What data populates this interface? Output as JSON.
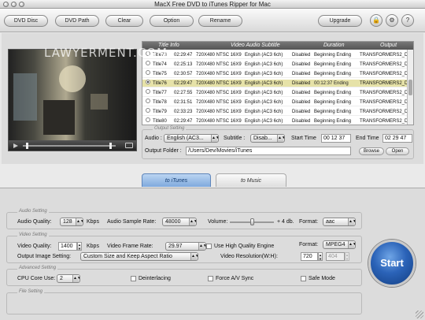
{
  "window": {
    "title": "MacX Free DVD to iTunes Ripper for Mac"
  },
  "toolbar": {
    "dvd_disc": "DVD Disc",
    "dvd_path": "DVD Path",
    "clear": "Clear",
    "option": "Option",
    "rename": "Rename",
    "upgrade": "Upgrade",
    "question_glyph": "?",
    "lock_glyph": "🔒",
    "gear_glyph": "⚙"
  },
  "player": {
    "watermark": "LAWYERMENT.COM"
  },
  "table": {
    "headers": {
      "title": "Title Info",
      "video_audio": "Video Audio Subtitle",
      "duration": "Duration",
      "output": "Output"
    },
    "rows": [
      {
        "title": "Title73",
        "time": "02:29:47",
        "video": "720X480 NTSC 16X9",
        "audio": "English (AC3 6ch)",
        "sub": "Disabled",
        "duration": "Beginning Ending",
        "output": "TRANSFORMERS2_DISC",
        "selected": false
      },
      {
        "title": "Title74",
        "time": "02:25:13",
        "video": "720X480 NTSC 16X9",
        "audio": "English (AC3 6ch)",
        "sub": "Disabled",
        "duration": "Beginning Ending",
        "output": "TRANSFORMERS2_DISC",
        "selected": false
      },
      {
        "title": "Title75",
        "time": "02:30:57",
        "video": "720X480 NTSC 16X9",
        "audio": "English (AC3 6ch)",
        "sub": "Disabled",
        "duration": "Beginning Ending",
        "output": "TRANSFORMERS2_DISC",
        "selected": false
      },
      {
        "title": "Title76",
        "time": "02:29:47",
        "video": "720X480 NTSC 16X9",
        "audio": "English (AC3 6ch)",
        "sub": "Disabled",
        "duration": "00:12:37 Ending",
        "output": "TRANSFORMERS2_DISC",
        "selected": true
      },
      {
        "title": "Title77",
        "time": "02:27:55",
        "video": "720X480 NTSC 16X9",
        "audio": "English (AC3 6ch)",
        "sub": "Disabled",
        "duration": "Beginning Ending",
        "output": "TRANSFORMERS2_DISC",
        "selected": false
      },
      {
        "title": "Title78",
        "time": "02:31:51",
        "video": "720X480 NTSC 16X9",
        "audio": "English (AC3 6ch)",
        "sub": "Disabled",
        "duration": "Beginning Ending",
        "output": "TRANSFORMERS2_DISC",
        "selected": false
      },
      {
        "title": "Title79",
        "time": "02:33:23",
        "video": "720X480 NTSC 16X9",
        "audio": "English (AC3 6ch)",
        "sub": "Disabled",
        "duration": "Beginning Ending",
        "output": "TRANSFORMERS2_DISC",
        "selected": false
      },
      {
        "title": "Title80",
        "time": "02:29:47",
        "video": "720X480 NTSC 16X9",
        "audio": "English (AC3 6ch)",
        "sub": "Disabled",
        "duration": "Beginning Ending",
        "output": "TRANSFORMERS2_DISC",
        "selected": false
      }
    ]
  },
  "output_setting": {
    "group_title": "Output Setting",
    "audio_label": "Audio :",
    "audio_value": "English (AC3...",
    "subtitle_label": "Subtitle :",
    "subtitle_value": "Disab...",
    "start_time_label": "Start Time",
    "start_time": "00 12 37",
    "end_time_label": "End Time",
    "end_time": "02 29 47",
    "folder_label": "Output Folder :",
    "folder_value": "/Users/Dev/Movies/iTunes",
    "browse": "Browse",
    "open": "Open"
  },
  "tabs": {
    "itunes": "to iTunes",
    "music": "to Music"
  },
  "audio_setting": {
    "group_title": "Audio Setting",
    "quality_label": "Audio Quality:",
    "quality_value": "128",
    "quality_unit": "Kbps",
    "sample_rate_label": "Audio Sample Rate:",
    "sample_rate_value": "48000",
    "volume_label": "Volume:",
    "volume_value": "+ 4 db.",
    "format_label": "Format:",
    "format_value": "aac"
  },
  "video_setting": {
    "group_title": "Video Setting",
    "quality_label": "Video Quality:",
    "quality_value": "1400",
    "quality_unit": "Kbps",
    "frame_rate_label": "Video Frame Rate:",
    "frame_rate_value": "29.97",
    "hq_engine_label": "Use High Quality Engine",
    "format_label": "Format:",
    "format_value": "MPEG4",
    "image_setting_label": "Output Image Setting:",
    "image_setting_value": "Custom Size and Keep Aspect Ratio",
    "resolution_label": "Video Resolution(W:H):",
    "width": "720",
    "height": "404"
  },
  "advanced_setting": {
    "group_title": "Advanced Setting",
    "cpu_label": "CPU Core Use:",
    "cpu_value": "2",
    "deinterlacing_label": "Deinterlacing",
    "force_sync_label": "Force A/V Sync",
    "safe_mode_label": "Safe Mode"
  },
  "file_setting": {
    "group_title": "File Setting"
  },
  "start_button": "Start"
}
